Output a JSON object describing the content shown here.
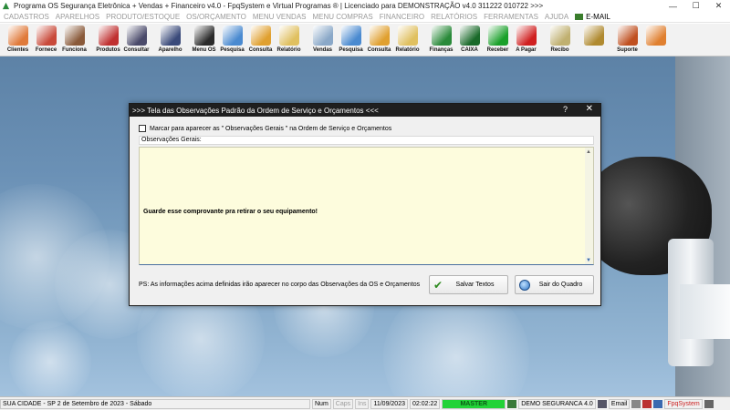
{
  "window": {
    "title": "Programa OS Segurança Eletrônica + Vendas + Financeiro v4.0 - FpqSystem e Virtual Programas ® | Licenciado para  DEMONSTRAÇÃO v4.0 311222 010722 >>>",
    "controls": [
      "—",
      "☐",
      "✕"
    ]
  },
  "menu": [
    "CADASTROS",
    "APARELHOS",
    "PRODUTO/ESTOQUE",
    "OS/ORÇAMENTO",
    "MENU VENDAS",
    "MENU COMPRAS",
    "FINANCEIRO",
    "RELATÓRIOS",
    "FERRAMENTAS",
    "AJUDA"
  ],
  "menu_email": "E-MAIL",
  "toolbar": [
    {
      "label": "Clientes",
      "color": "#e07a3a"
    },
    {
      "label": "Fornece",
      "color": "#c94a3a"
    },
    {
      "label": "Funciona",
      "color": "#8a5a3a"
    },
    {
      "label": "Produtos",
      "color": "#c03030"
    },
    {
      "label": "Consultar",
      "color": "#4a4a6a"
    },
    {
      "label": "Aparelho",
      "color": "#3a4a7a"
    },
    {
      "label": "Menu OS",
      "color": "#2a2a2a"
    },
    {
      "label": "Pesquisa",
      "color": "#4a8ad0"
    },
    {
      "label": "Consulta",
      "color": "#e0a030"
    },
    {
      "label": "Relatório",
      "color": "#e0c060"
    },
    {
      "label": "Vendas",
      "color": "#8aa8c8"
    },
    {
      "label": "Pesquisa",
      "color": "#4a8ad0"
    },
    {
      "label": "Consulta",
      "color": "#e0a030"
    },
    {
      "label": "Relatório",
      "color": "#e0c060"
    },
    {
      "label": "Finanças",
      "color": "#2a8a3a"
    },
    {
      "label": "CAIXA",
      "color": "#1a6a2a"
    },
    {
      "label": "Receber",
      "color": "#1aa02a"
    },
    {
      "label": "A Pagar",
      "color": "#d02020"
    },
    {
      "label": "Recibo",
      "color": "#c0b070"
    },
    {
      "label": "",
      "color": "#b08a30"
    },
    {
      "label": "Suporte",
      "color": "#c05020"
    },
    {
      "label": "",
      "color": "#e08030"
    }
  ],
  "dialog": {
    "title": ">>>  Tela das Observações Padrão da Ordem de Serviço e Orçamentos  <<<",
    "help": "?",
    "close": "✕",
    "checkbox_label": "Marcar para aparecer as \" Observações Gerais \" na Ordem de Serviço e Orçamentos",
    "obs_label": "Observações Gerais:",
    "obs_text": "Guarde esse comprovante pra retirar o seu equipamento!",
    "ps_text": "PS: As informações acima definidas irão aparecer no corpo das Observações da OS e Orçamentos",
    "save_label": "Salvar Textos",
    "exit_label": "Sair do Quadro"
  },
  "status": {
    "city": "SUA CIDADE - SP  2 de Setembro de 2023 - Sábado",
    "num": "Num",
    "caps": "Caps",
    "ins": "Ins",
    "date": "11/09/2023",
    "time": "02:02:22",
    "master": "MASTER",
    "license": "DEMO SEGURANCA 4.0",
    "email": "Email",
    "brand": "FpqSystem"
  }
}
